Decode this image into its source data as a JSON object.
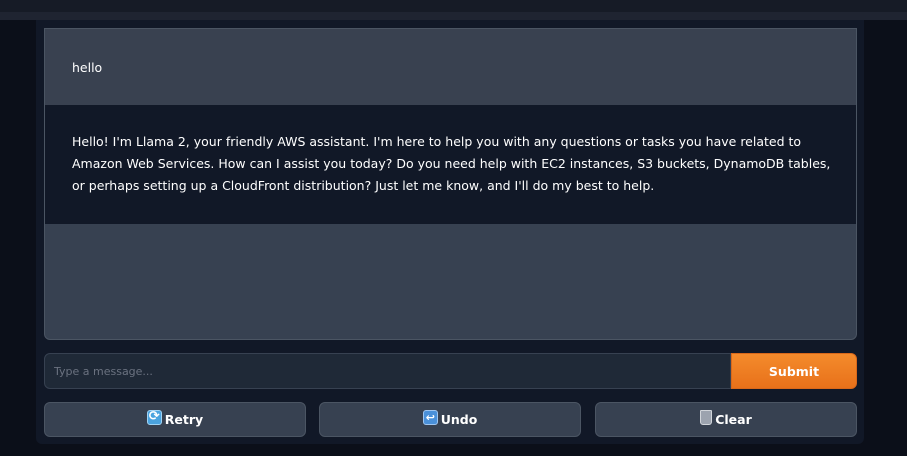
{
  "chat": {
    "user_message": "hello",
    "bot_message": "Hello! I'm Llama 2, your friendly AWS assistant. I'm here to help you with any questions or tasks you have related to Amazon Web Services. How can I assist you today? Do you need help with EC2 instances, S3 buckets, DynamoDB tables, or perhaps setting up a CloudFront distribution? Just let me know, and I'll do my best to help."
  },
  "input": {
    "placeholder": "Type a message...",
    "value": ""
  },
  "buttons": {
    "submit_label": "Submit",
    "retry_label": "Retry",
    "undo_label": "Undo",
    "clear_label": "Clear"
  },
  "icons": {
    "retry": "retry-icon",
    "undo": "undo-icon",
    "clear": "trash-icon"
  },
  "colors": {
    "accent": "#e8711a",
    "background": "#0b0f19",
    "panel": "#111827"
  }
}
